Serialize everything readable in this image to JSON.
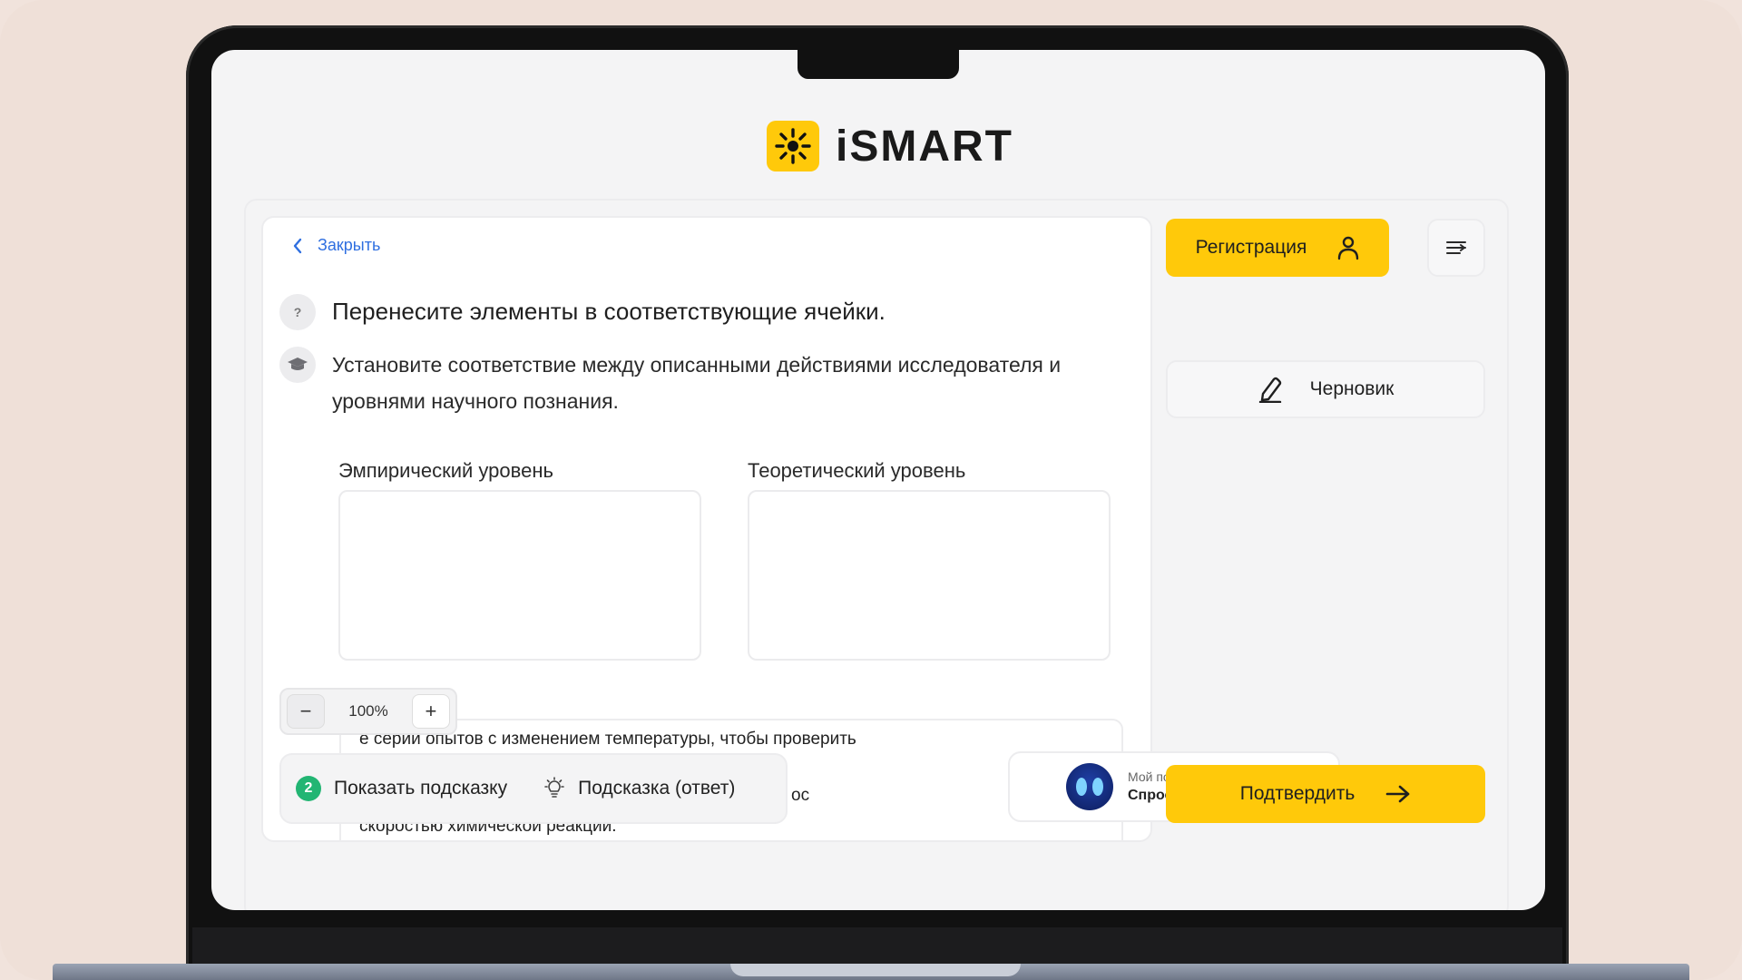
{
  "brand": {
    "name": "iSMART",
    "icon": "sun-icon",
    "accent": "#ffc90a"
  },
  "nav": {
    "close_label": "Закрыть"
  },
  "task": {
    "title": "Перенесите элементы в соответствующие ячейки.",
    "description": "Установите соответствие между описанными действиями исследователя и уровнями научного познания.",
    "columns": [
      {
        "label": "Эмпирический уровень"
      },
      {
        "label": "Теоретический уровень"
      }
    ],
    "item_lines": [
      "е серии опытов с изменением температуры, чтобы проверить",
      "скоростью химической реакции."
    ],
    "item_fragment": "ос"
  },
  "zoom": {
    "value": "100%",
    "minus": "−",
    "plus": "+"
  },
  "hints": {
    "count": "2",
    "show_hint_label": "Показать подсказку",
    "answer_hint_label": "Подсказка (ответ)"
  },
  "assistant": {
    "subtitle": "Мой помощник",
    "title": "Спроси меня"
  },
  "sidebar": {
    "register_label": "Регистрация",
    "draft_label": "Черновик",
    "confirm_label": "Подтвердить"
  }
}
